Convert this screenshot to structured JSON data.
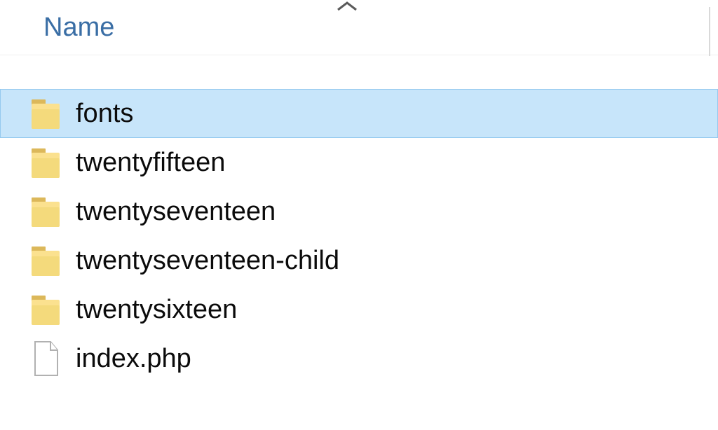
{
  "header": {
    "name_column_label": "Name"
  },
  "items": [
    {
      "name": "fonts",
      "type": "folder",
      "selected": true
    },
    {
      "name": "twentyfifteen",
      "type": "folder",
      "selected": false
    },
    {
      "name": "twentyseventeen",
      "type": "folder",
      "selected": false
    },
    {
      "name": "twentyseventeen-child",
      "type": "folder",
      "selected": false
    },
    {
      "name": "twentysixteen",
      "type": "folder",
      "selected": false
    },
    {
      "name": "index.php",
      "type": "file",
      "selected": false
    }
  ]
}
